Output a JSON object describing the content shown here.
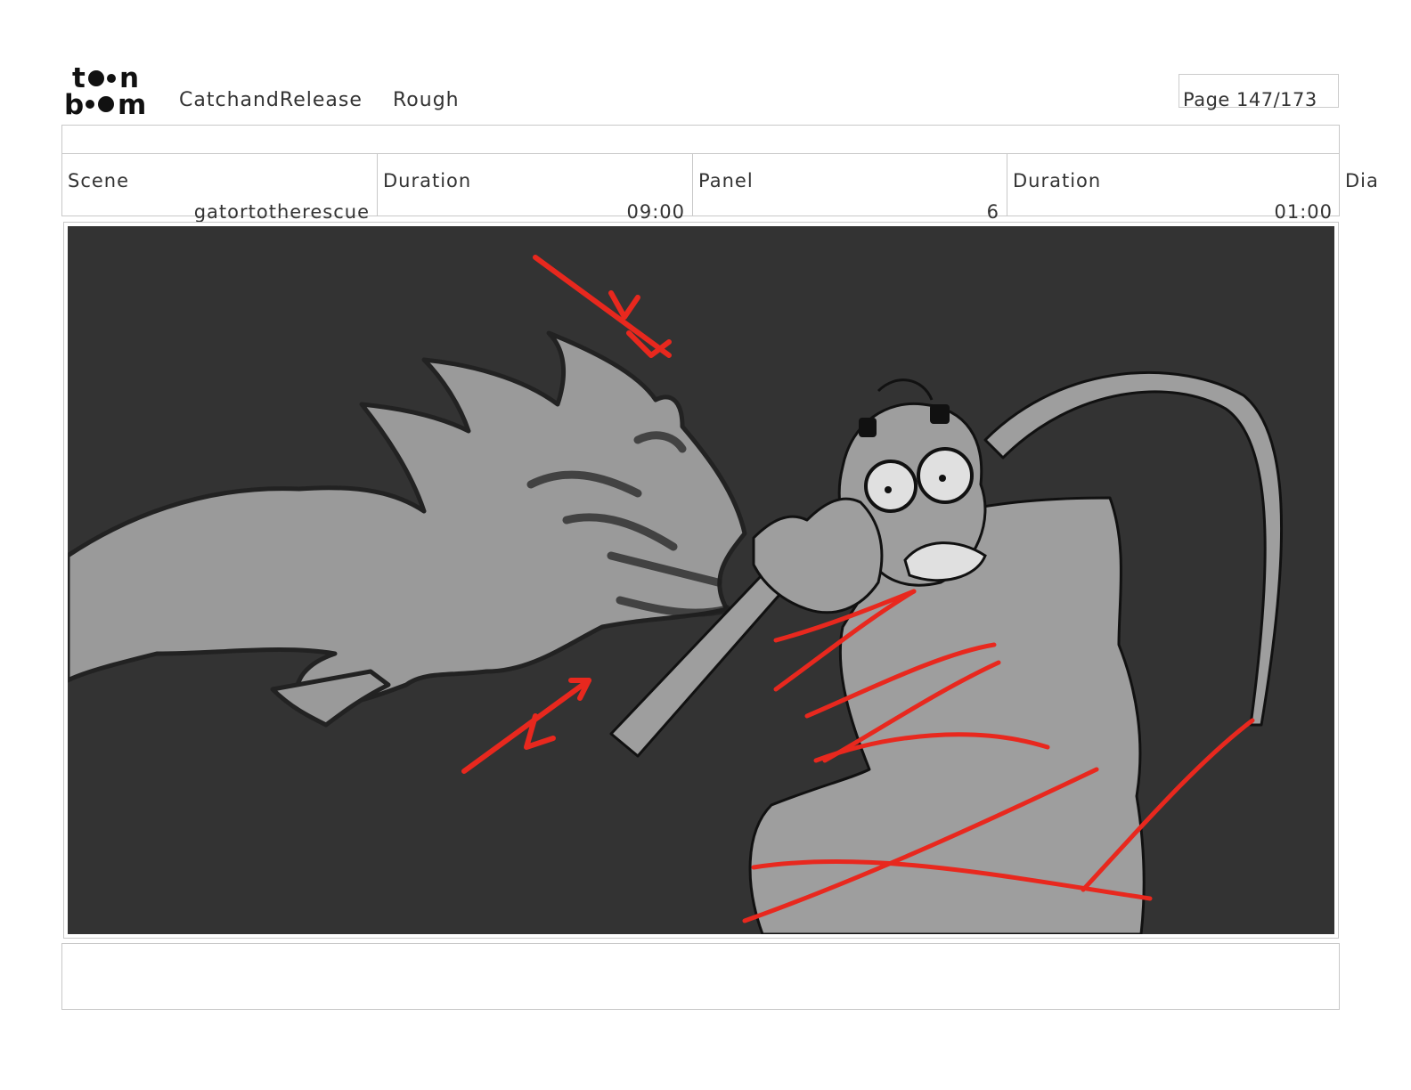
{
  "header": {
    "logo": "toon boom",
    "project": "CatchandRelease",
    "stage": "Rough",
    "page": "Page 147/173"
  },
  "info": {
    "scene_label": "Scene",
    "scene_value": "gatortotherescue",
    "scene_duration_label": "Duration",
    "scene_duration_value": "09:00",
    "panel_label": "Panel",
    "panel_value": "6",
    "panel_duration_label": "Duration",
    "panel_duration_value": "01:00",
    "dialogue_label": "Dia"
  },
  "colors": {
    "panel_background": "#333333",
    "figure_gray": "#999999",
    "annotation_red": "#e8281e"
  }
}
